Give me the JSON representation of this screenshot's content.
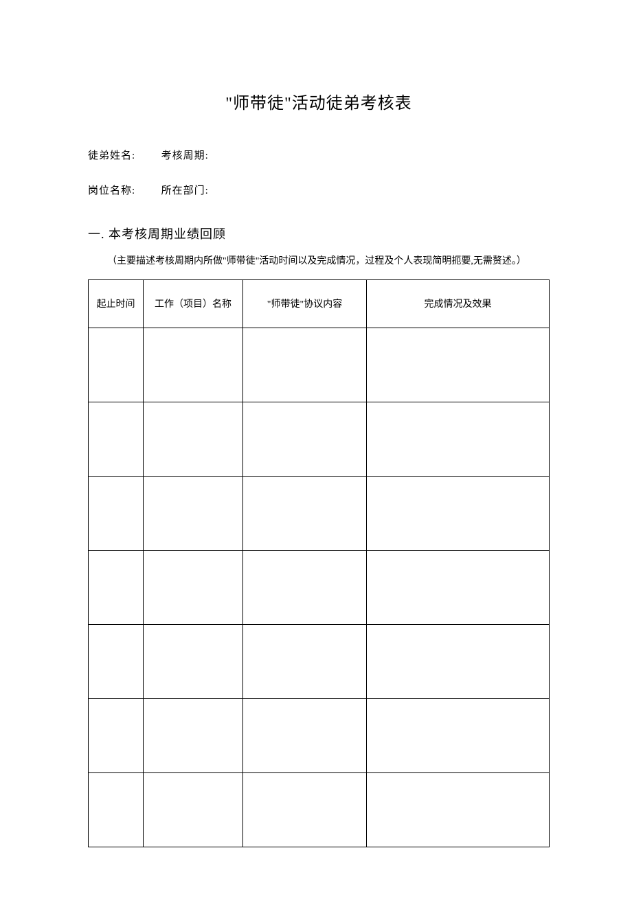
{
  "title": "\"师带徒\"活动徒弟考核表",
  "info": {
    "line1": {
      "label1": "徒弟姓名:",
      "label2": "考核周期:"
    },
    "line2": {
      "label1": "岗位名称:",
      "label2": "所在部门:"
    }
  },
  "section": {
    "heading": "一. 本考核周期业绩回顾",
    "note": "（主要描述考核周期内所做\"师带徒\"活动时间以及完成情况，过程及个人表现简明扼要,无需赘述。）"
  },
  "table": {
    "headers": {
      "col1": "起止时间",
      "col2": "工作（项目）名称",
      "col3": "\"师带徒\"协议内容",
      "col4": "完成情况及效果"
    },
    "rows": [
      {
        "col1": "",
        "col2": "",
        "col3": "",
        "col4": ""
      },
      {
        "col1": "",
        "col2": "",
        "col3": "",
        "col4": ""
      },
      {
        "col1": "",
        "col2": "",
        "col3": "",
        "col4": ""
      },
      {
        "col1": "",
        "col2": "",
        "col3": "",
        "col4": ""
      },
      {
        "col1": "",
        "col2": "",
        "col3": "",
        "col4": ""
      },
      {
        "col1": "",
        "col2": "",
        "col3": "",
        "col4": ""
      },
      {
        "col1": "",
        "col2": "",
        "col3": "",
        "col4": ""
      }
    ]
  }
}
